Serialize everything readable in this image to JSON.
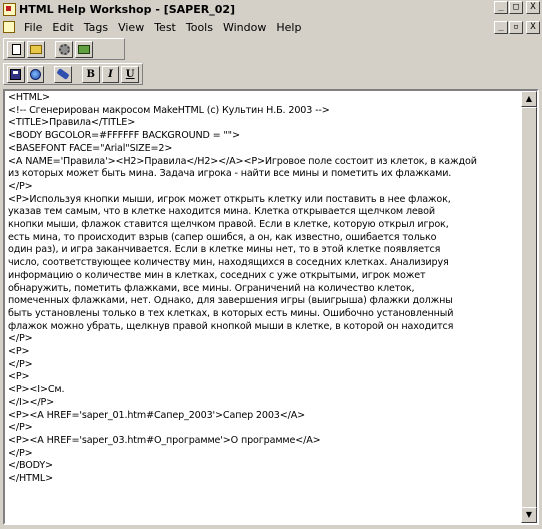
{
  "window": {
    "title": "HTML Help Workshop - [SAPER_02]",
    "controls": [
      "_",
      "□",
      "X"
    ],
    "mdi_controls": [
      "_",
      "▫",
      "X"
    ]
  },
  "menu": [
    "File",
    "Edit",
    "Tags",
    "View",
    "Test",
    "Tools",
    "Window",
    "Help"
  ],
  "toolbar1": [
    "new-document-icon",
    "open-folder-icon",
    "compile-icon",
    "view-compiled-icon"
  ],
  "toolbar2": {
    "icons": [
      "save-icon",
      "browser-view-icon",
      "brush-icon"
    ],
    "bold": "B",
    "italic": "I",
    "underline": "U"
  },
  "editor": {
    "lines": [
      "<HTML>",
      "<!-- Сгенерирован макросом MakeHTML (c) Культин Н.Б. 2003 -->",
      "<TITLE>Правила</TITLE>",
      "<BODY BGCOLOR=#FFFFFF BACKGROUND = \"\">",
      "<BASEFONT FACE=\"Arial\"SIZE=2>",
      "<A NAME='Правила'><H2>Правила</H2></A><P>Игровое поле состоит из клеток, в каждой",
      "из которых может быть мина. Задача игрока - найти все мины и пометить их флажками.",
      "</P>",
      "<P>Используя кнопки мыши, игрок может открыть клетку или поставить в нее флажок,",
      "указав тем самым, что в клетке находится мина. Клетка открывается щелчком левой",
      "кнопки мыши, флажок ставится щелчком правой. Если в клетке, которую открыл игрок,",
      "есть мина, то происходит взрыв (сапер ошибся, а он, как известно, ошибается только",
      "один раз), и игра заканчивается. Если в клетке мины нет, то в этой клетке появляется",
      "число, соответствующее количеству мин, находящихся в соседних клетках. Анализируя",
      "информацию о количестве мин в клетках, соседних с уже открытыми, игрок может",
      "обнаружить, пометить флажками, все мины. Ограничений на количество клеток,",
      "помеченных флажками, нет. Однако, для завершения игры (выигрыша) флажки должны",
      "быть установлены только в тех клетках, в которых есть мины. Ошибочно установленный",
      "флажок можно убрать, щелкнув правой кнопкой мыши в клетке, в которой он находится",
      "</P>",
      "<P>",
      "</P>",
      "<P>",
      "<P><I>См.",
      "</I></P>",
      "<P><A HREF='saper_01.htm#Сапер_2003'>Сапер 2003</A>",
      "</P>",
      "<P><A HREF='saper_03.htm#O_программе'>О программе</A>",
      "</P>",
      "</BODY>",
      "</HTML>"
    ]
  }
}
